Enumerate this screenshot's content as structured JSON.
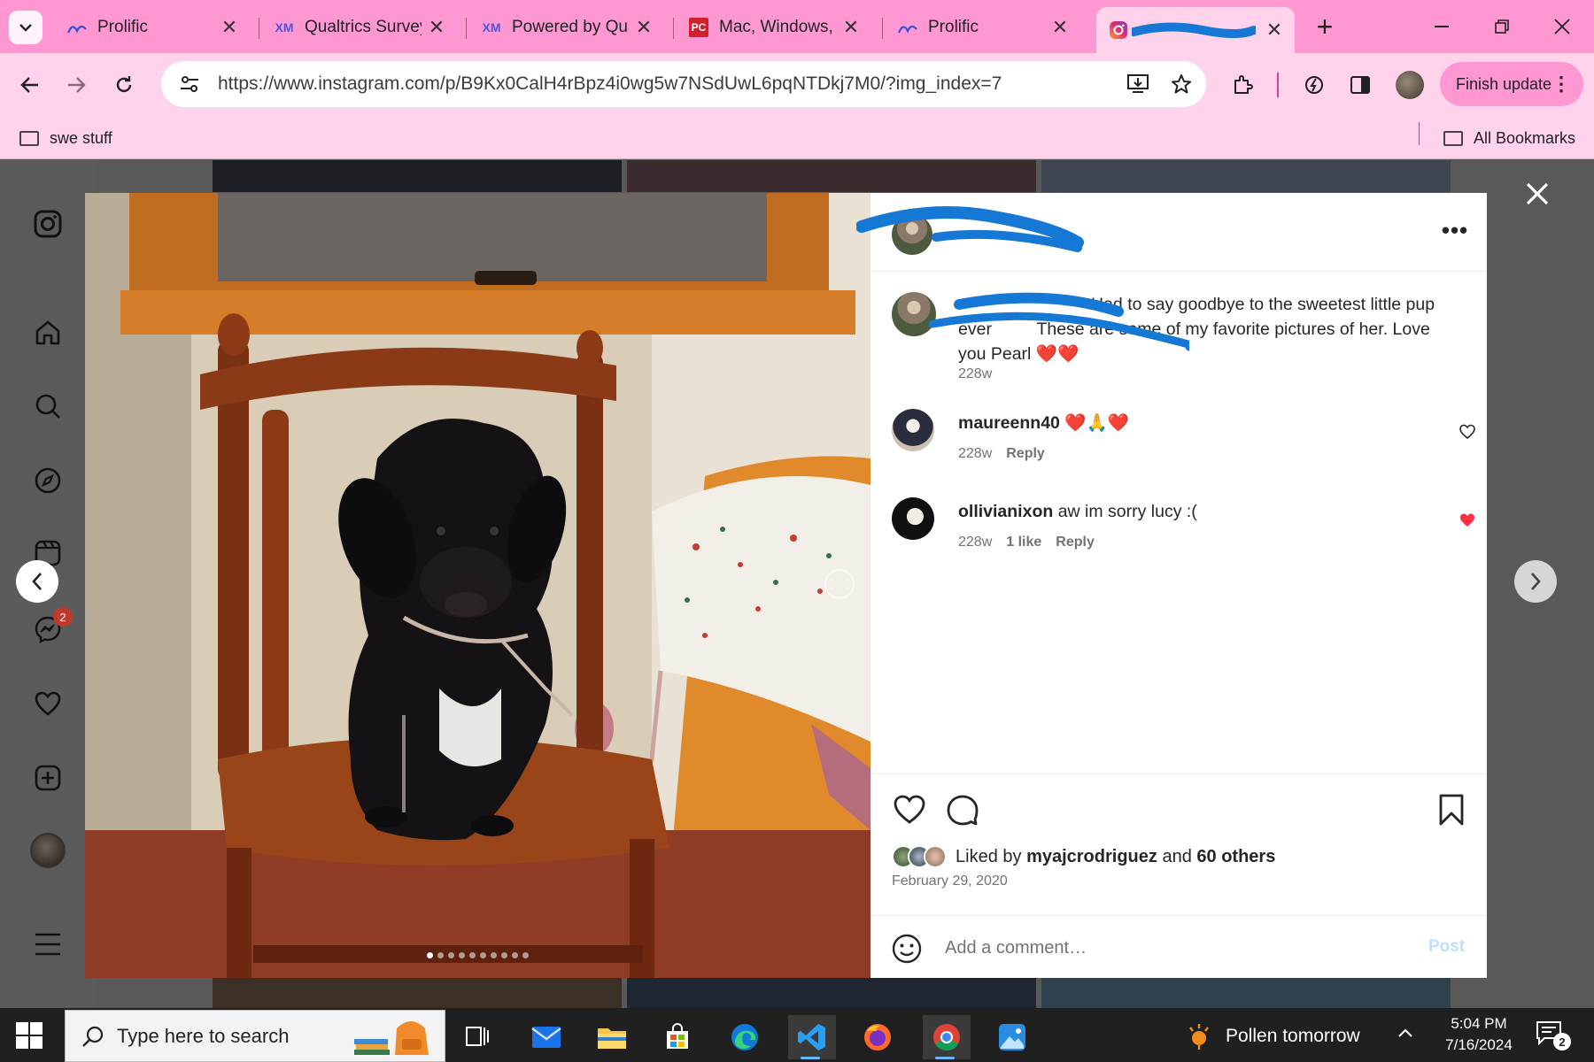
{
  "browser": {
    "tabs": [
      {
        "title": "Prolific",
        "icon": "prolific-icon"
      },
      {
        "title": "Qualtrics Survey",
        "icon": "qualtrics-icon"
      },
      {
        "title": "Powered by Qua",
        "icon": "qualtrics-icon"
      },
      {
        "title": "Mac, Windows, (",
        "icon": "pcmag-icon"
      },
      {
        "title": "Prolific",
        "icon": "prolific-icon"
      },
      {
        "title": "",
        "icon": "instagram-icon",
        "active": true
      }
    ],
    "url": "https://www.instagram.com/p/B9Kx0CalH4rBpz4i0wg5w7NSdUwL6pqNTDkj7M0/?img_index=7",
    "finish_update_label": "Finish update",
    "bookmarks": {
      "left": "swe stuff",
      "right": "All Bookmarks"
    }
  },
  "instagram": {
    "sidebar_badge": "2",
    "photo": {
      "slide_count": 10,
      "active_index": 0
    },
    "post": {
      "caption_text": "Had to say goodbye to the sweetest little pup ever ",
      "caption_text_2": "These are some of my favorite pictures of her. Love you Pearl",
      "caption_time": "228w",
      "comments": [
        {
          "user": "maureenn40",
          "text": "",
          "time": "228w",
          "likes": "",
          "reply": "Reply",
          "liked": false
        },
        {
          "user": "ollivianixon",
          "text": "aw im sorry lucy :(",
          "time": "228w",
          "likes": "1 like",
          "reply": "Reply",
          "liked": true
        }
      ],
      "liked_by_prefix": "Liked by",
      "liked_by_user": "myajcrodriguez",
      "liked_by_and": "and",
      "liked_by_others": "60 others",
      "date": "February 29, 2020",
      "comment_placeholder": "Add a comment…",
      "post_label": "Post"
    }
  },
  "taskbar": {
    "search_placeholder": "Type here to search",
    "weather": "Pollen tomorrow",
    "time": "5:04 PM",
    "date": "7/16/2024",
    "notifications": "2"
  },
  "colors": {
    "tabstrip": "#ff97d2",
    "toolbar": "#ffd3ec",
    "scribble": "#1478d4",
    "heart_red": "#ff3040"
  }
}
